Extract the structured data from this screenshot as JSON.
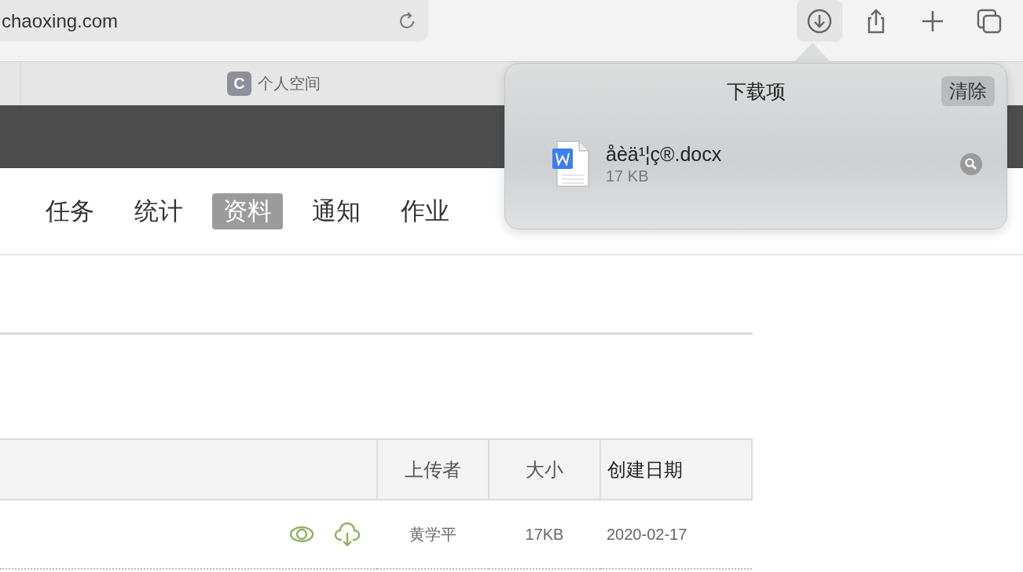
{
  "toolbar": {
    "address": "chaoxing.com"
  },
  "tabs": [
    {
      "favicon": "C",
      "title": "个人空间"
    }
  ],
  "nav": [
    {
      "label": "任务",
      "selected": false
    },
    {
      "label": "统计",
      "selected": false
    },
    {
      "label": "资料",
      "selected": true
    },
    {
      "label": "通知",
      "selected": false
    },
    {
      "label": "作业",
      "selected": false
    }
  ],
  "table": {
    "columns": [
      "上传者",
      "大小",
      "创建日期"
    ],
    "rows": [
      {
        "cells": [
          "黄学平",
          "17KB",
          "2020-02-17"
        ]
      }
    ]
  },
  "downloads": {
    "title": "下载项",
    "clear": "清除",
    "items": [
      {
        "name": "åèä¹¦ç®.docx",
        "size": "17 KB"
      }
    ]
  }
}
